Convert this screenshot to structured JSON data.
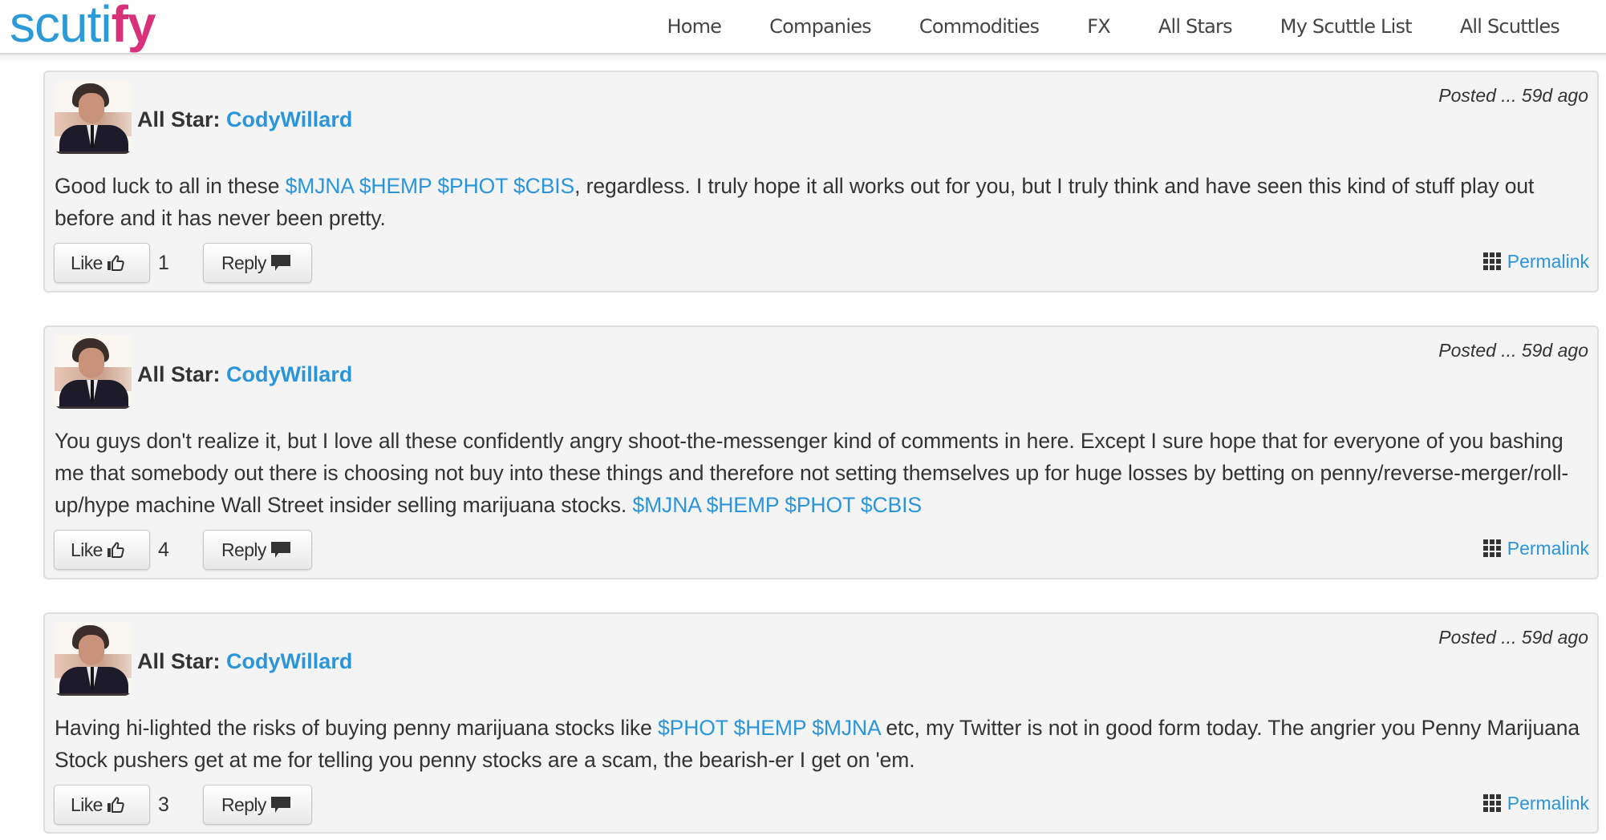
{
  "header": {
    "logo_part1": "scuti",
    "logo_part2": "fy",
    "nav": [
      {
        "label": "Home"
      },
      {
        "label": "Companies"
      },
      {
        "label": "Commodities"
      },
      {
        "label": "FX"
      },
      {
        "label": "All Stars"
      },
      {
        "label": "My Scuttle List"
      },
      {
        "label": "All Scuttles"
      }
    ]
  },
  "colors": {
    "link": "#2a95db",
    "logo_blue": "#2d9ad8",
    "logo_magenta": "#d6317a",
    "card_bg": "#f4f4f4",
    "text": "#333333"
  },
  "posts": [
    {
      "author_label": "All Star:",
      "author_name": "CodyWillard",
      "posted": "Posted ... 59d ago",
      "body": [
        {
          "type": "text",
          "value": "Good luck to all in these "
        },
        {
          "type": "link",
          "value": "$MJNA"
        },
        {
          "type": "text",
          "value": " "
        },
        {
          "type": "link",
          "value": "$HEMP"
        },
        {
          "type": "text",
          "value": " "
        },
        {
          "type": "link",
          "value": "$PHOT"
        },
        {
          "type": "text",
          "value": " "
        },
        {
          "type": "link",
          "value": "$CBIS"
        },
        {
          "type": "text",
          "value": ", regardless. I truly hope it all works out for you, but I truly think and have seen this kind of stuff play out before and it has never been pretty."
        }
      ],
      "like_label": "Like",
      "like_count": "1",
      "reply_label": "Reply",
      "permalink_label": "Permalink"
    },
    {
      "author_label": "All Star:",
      "author_name": "CodyWillard",
      "posted": "Posted ... 59d ago",
      "body": [
        {
          "type": "text",
          "value": "You guys don't realize it, but I love all these confidently angry shoot-the-messenger kind of comments in here. Except I sure hope that for everyone of you bashing me that somebody out there is choosing not buy into these things and therefore not setting themselves up for huge losses by betting on penny/reverse-merger/roll-up/hype machine Wall Street insider selling marijuana stocks. "
        },
        {
          "type": "link",
          "value": "$MJNA"
        },
        {
          "type": "text",
          "value": " "
        },
        {
          "type": "link",
          "value": "$HEMP"
        },
        {
          "type": "text",
          "value": " "
        },
        {
          "type": "link",
          "value": "$PHOT"
        },
        {
          "type": "text",
          "value": " "
        },
        {
          "type": "link",
          "value": "$CBIS"
        }
      ],
      "like_label": "Like",
      "like_count": "4",
      "reply_label": "Reply",
      "permalink_label": "Permalink"
    },
    {
      "author_label": "All Star:",
      "author_name": "CodyWillard",
      "posted": "Posted ... 59d ago",
      "body": [
        {
          "type": "text",
          "value": "Having hi-lighted the risks of buying penny marijuana stocks like "
        },
        {
          "type": "link",
          "value": "$PHOT"
        },
        {
          "type": "text",
          "value": " "
        },
        {
          "type": "link",
          "value": "$HEMP"
        },
        {
          "type": "text",
          "value": " "
        },
        {
          "type": "link",
          "value": "$MJNA"
        },
        {
          "type": "text",
          "value": " etc, my Twitter is not in good form today. The angrier you Penny Marijuana Stock pushers get at me for telling you penny stocks are a scam, the bearish-er I get on 'em."
        }
      ],
      "like_label": "Like",
      "like_count": "3",
      "reply_label": "Reply",
      "permalink_label": "Permalink"
    }
  ],
  "icons": {
    "like": "thumbs-up-icon",
    "reply": "comment-icon",
    "permalink": "grid-icon"
  }
}
